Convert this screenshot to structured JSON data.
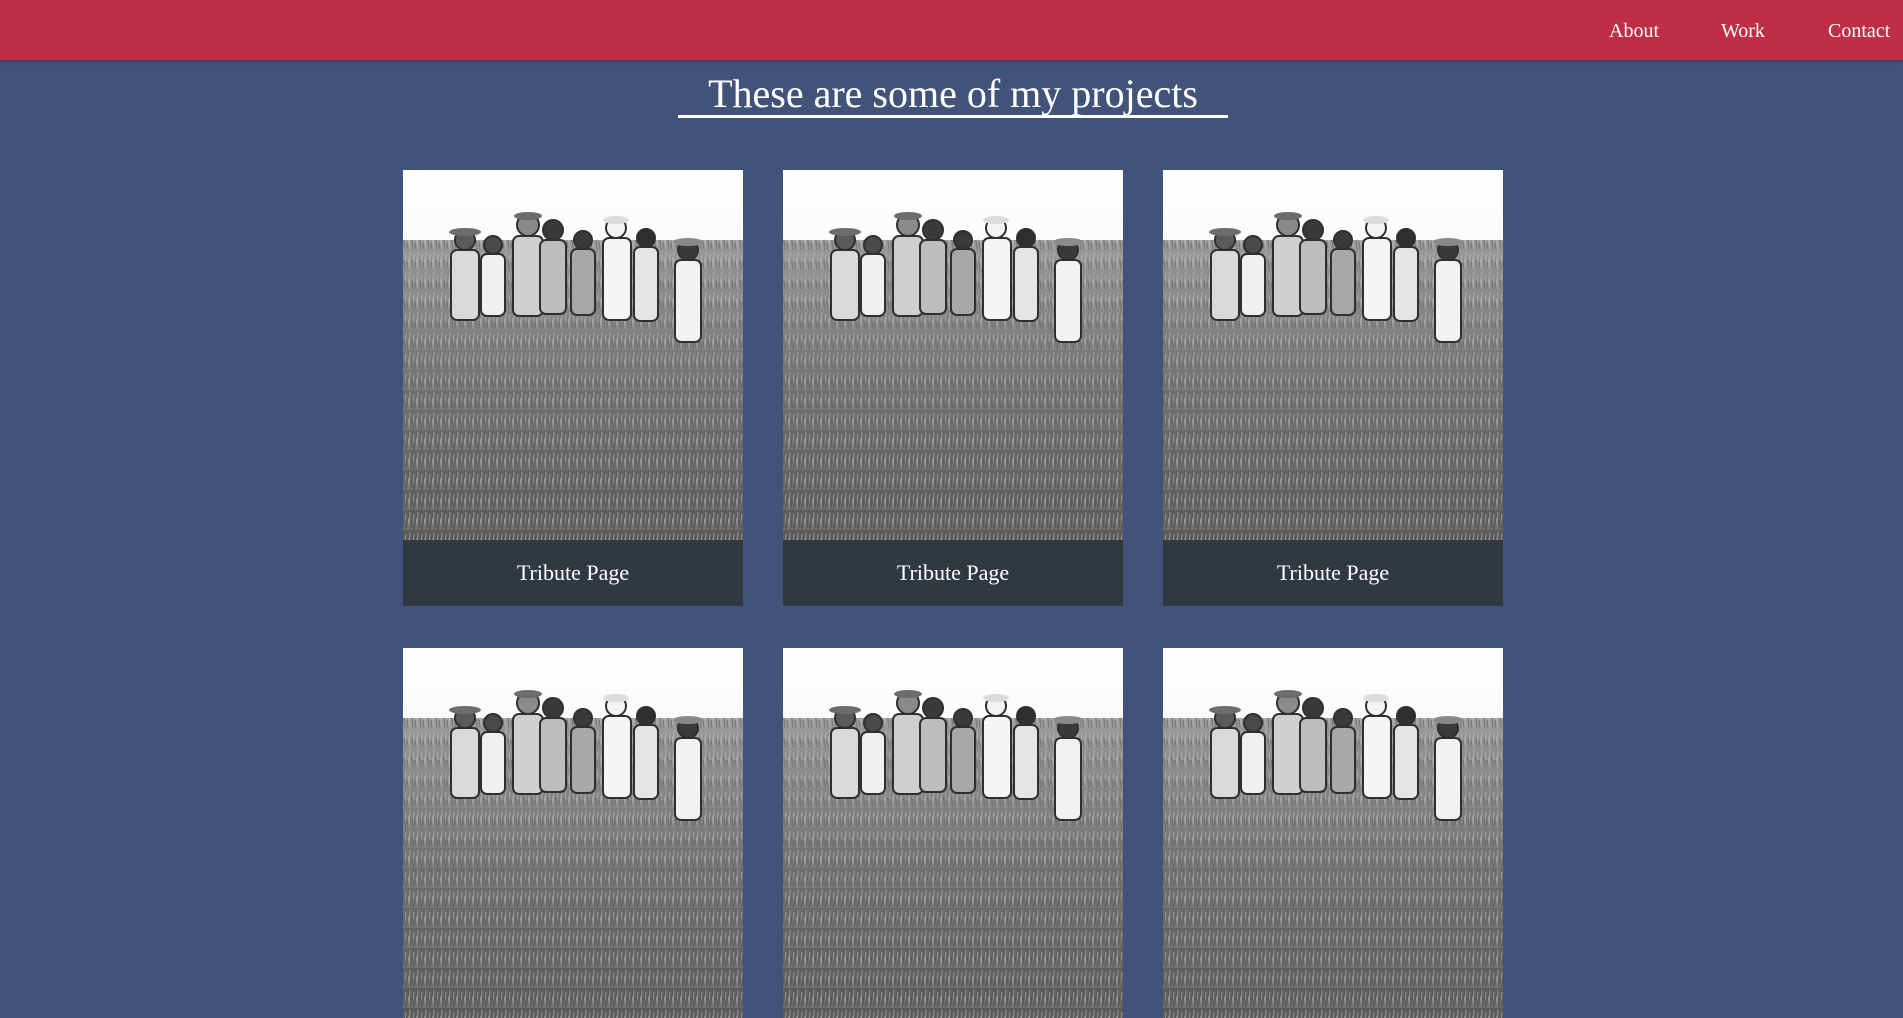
{
  "nav": {
    "about_label": "About",
    "work_label": "Work",
    "contact_label": "Contact"
  },
  "projects": {
    "title": "These are some of my projects",
    "tiles": [
      {
        "label": "Tribute Page"
      },
      {
        "label": "Tribute Page"
      },
      {
        "label": "Tribute Page"
      },
      {
        "label": ""
      },
      {
        "label": ""
      },
      {
        "label": ""
      }
    ]
  },
  "colors": {
    "navbar": "#be2e45",
    "background": "#415379",
    "caption": "#303841",
    "text": "#ffffff"
  }
}
